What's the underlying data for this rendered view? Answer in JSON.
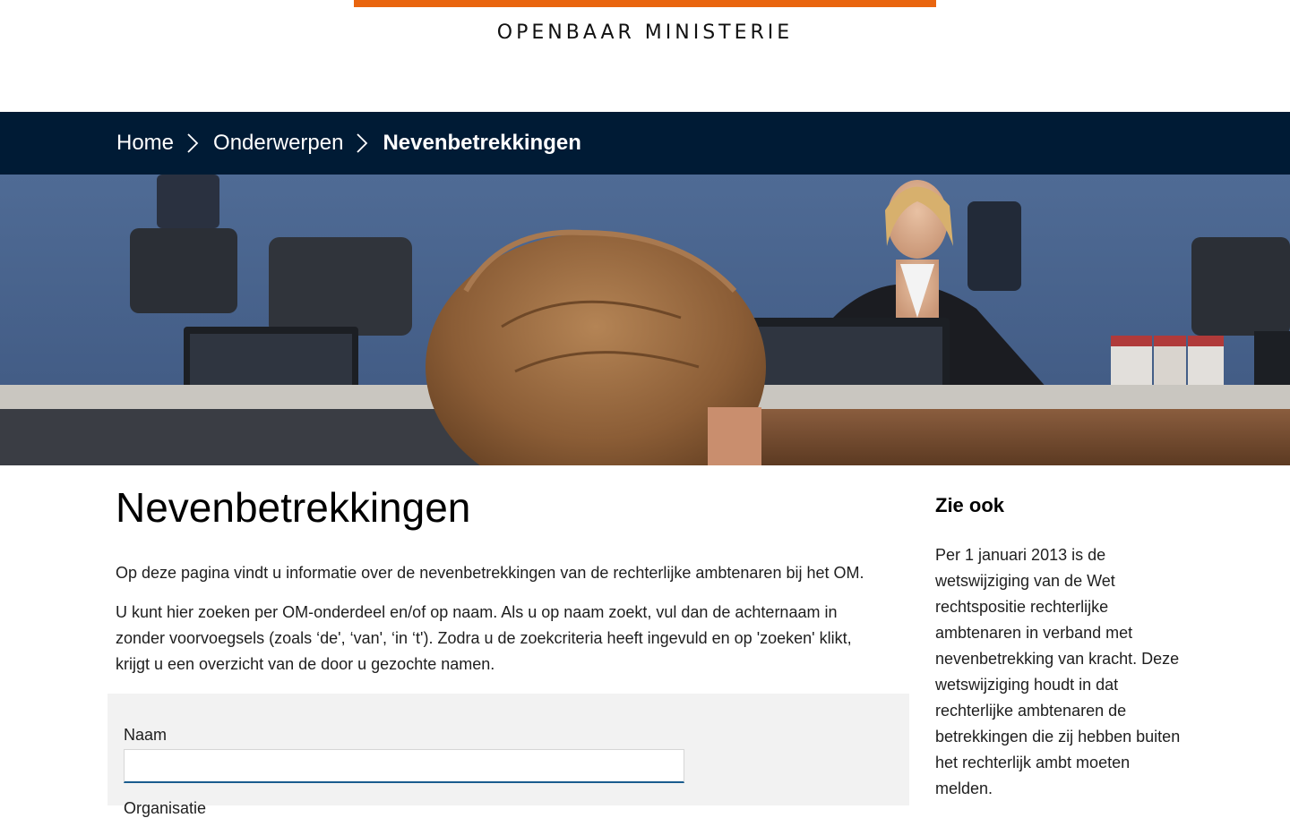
{
  "header": {
    "logo_text": "OPENBAAR MINISTERIE",
    "brand_color": "#e9650f"
  },
  "breadcrumb": {
    "items": [
      {
        "label": "Home"
      },
      {
        "label": "Onderwerpen"
      },
      {
        "label": "Nevenbetrekkingen"
      }
    ],
    "background": "#001b35"
  },
  "main": {
    "title": "Nevenbetrekkingen",
    "intro": "Op deze pagina vindt u informatie over de nevenbetrekkingen van de rechterlijke ambtenaren bij het OM.",
    "instructions": "U kunt hier zoeken per OM-onderdeel en/of op naam. Als u op naam zoekt, vul dan de achternaam in zonder voorvoegsels (zoals ‘de', ‘van', ‘in ‘t'). Zodra u de zoekcriteria heeft ingevuld en op 'zoeken' klikt, krijgt u een overzicht van de door u gezochte namen."
  },
  "form": {
    "name_label": "Naam",
    "name_value": "",
    "second_label": "Organisatie"
  },
  "aside": {
    "title": "Zie ook",
    "text": "Per 1 januari 2013 is de wetswijziging van de Wet rechtspositie rechterlijke ambtenaren in verband met nevenbetrekking van  kracht. Deze wetswijziging houdt in dat rechterlijke ambtenaren de betrekkingen die zij hebben buiten het rechterlijk ambt moeten melden."
  }
}
